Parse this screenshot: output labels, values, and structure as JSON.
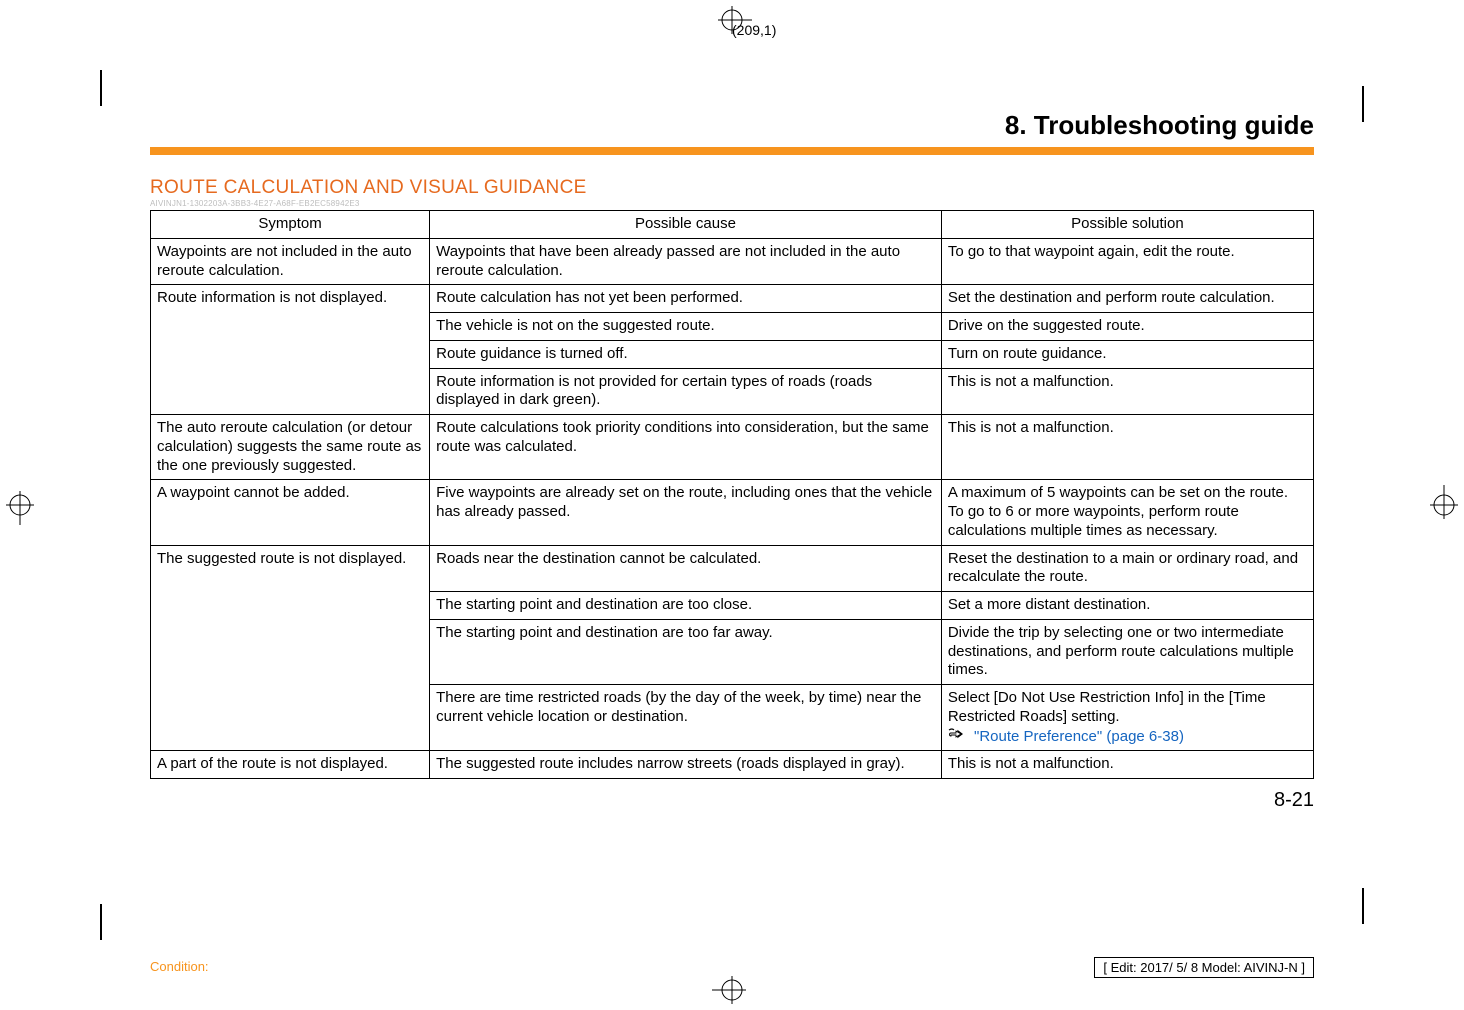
{
  "page_num_top": "(209,1)",
  "chapter": "8. Troubleshooting guide",
  "heading": "ROUTE CALCULATION AND VISUAL GUIDANCE",
  "doc_id": "AIVINJN1-1302203A-3BB3-4E27-A68F-EB2EC58942E3",
  "th": {
    "symptom": "Symptom",
    "cause": "Possible cause",
    "solution": "Possible solution"
  },
  "rows": [
    {
      "symptom": "Waypoints are not included in the auto reroute calculation.",
      "cause": "Waypoints that have been already passed are not included in the auto reroute calculation.",
      "solution": "To go to that waypoint again, edit the route."
    },
    {
      "symptom": "Route information is not displayed.",
      "cause": "Route calculation has not yet been performed.",
      "solution": "Set the destination and perform route calculation."
    },
    {
      "cause": "The vehicle is not on the suggested route.",
      "solution": "Drive on the suggested route."
    },
    {
      "cause": "Route guidance is turned off.",
      "solution": "Turn on route guidance."
    },
    {
      "cause": "Route information is not provided for certain types of roads (roads displayed in dark green).",
      "solution": "This is not a malfunction."
    },
    {
      "symptom": "The auto reroute calculation (or detour calculation) suggests the same route as the one previously suggested.",
      "cause": "Route calculations took priority conditions into consideration, but the same route was calculated.",
      "solution": "This is not a malfunction."
    },
    {
      "symptom": "A waypoint cannot be added.",
      "cause": "Five waypoints are already set on the route, including ones that the vehicle has already passed.",
      "solution": "A maximum of 5 waypoints can be set on the route. To go to 6 or more waypoints, perform route calculations multiple times as necessary."
    },
    {
      "symptom": "The suggested route is not displayed.",
      "cause": "Roads near the destination cannot be calculated.",
      "solution": "Reset the destination to a main or ordinary road, and recalculate the route."
    },
    {
      "cause": "The starting point and destination are too close.",
      "solution": "Set a more distant destination."
    },
    {
      "cause": "The starting point and destination are too far away.",
      "solution": "Divide the trip by selecting one or two intermediate destinations, and perform route calculations multiple times."
    },
    {
      "cause": "There are time restricted roads (by the day of the week, by time) near the current vehicle location or destination.",
      "solution_pre": "Select [Do Not Use Restriction Info] in the [Time Restricted Roads] setting.",
      "solution_link": "\"Route Preference\" (page 6-38)"
    },
    {
      "symptom": "A part of the route is not displayed.",
      "cause": "The suggested route includes narrow streets (roads displayed in gray).",
      "solution": "This is not a malfunction."
    }
  ],
  "page_num_bottom": "8-21",
  "condition": "Condition:",
  "edit_info": "[ Edit: 2017/ 5/ 8   Model: AIVINJ-N ]"
}
